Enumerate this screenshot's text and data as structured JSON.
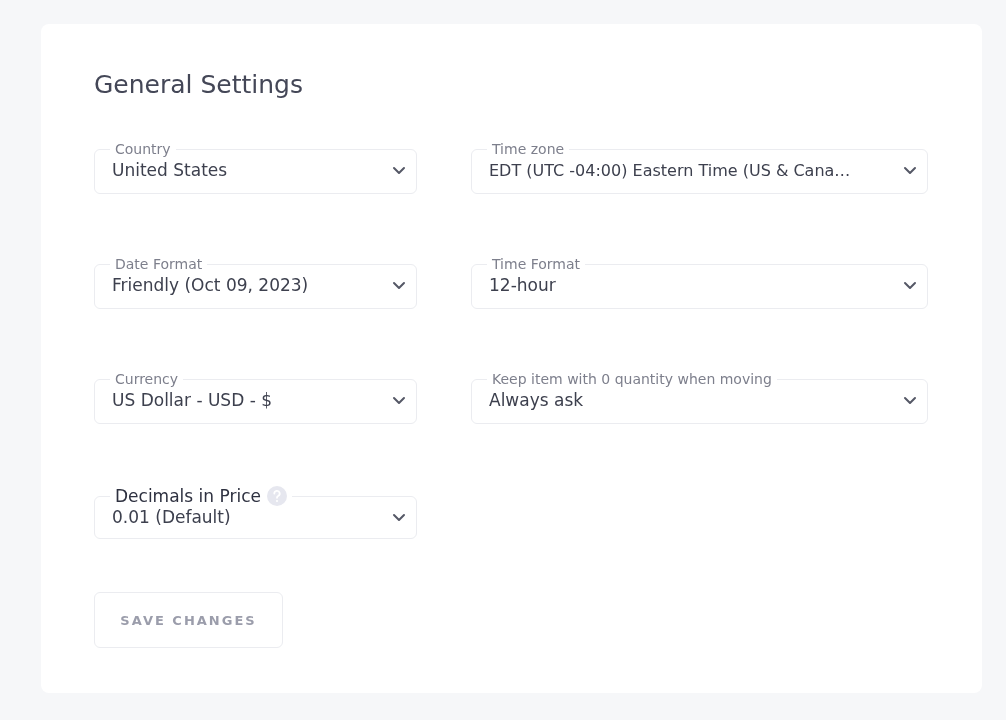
{
  "title": "General Settings",
  "fields": [
    {
      "label": "Country",
      "value": "United States",
      "help": false
    },
    {
      "label": "Time zone",
      "value": "EDT (UTC -04:00) Eastern Time (US & Cana…",
      "help": false
    },
    {
      "label": "Date Format",
      "value": "Friendly (Oct 09, 2023)",
      "help": false
    },
    {
      "label": "Time Format",
      "value": "12-hour",
      "help": false
    },
    {
      "label": "Currency",
      "value": "US Dollar - USD - $",
      "help": false
    },
    {
      "label": "Keep item with 0 quantity when moving",
      "value": "Always ask",
      "help": false
    },
    {
      "label": "Decimals in Price",
      "value": "0.01 (Default)",
      "help": true
    }
  ],
  "save_button": {
    "label": "SAVE CHANGES",
    "disabled": true
  }
}
